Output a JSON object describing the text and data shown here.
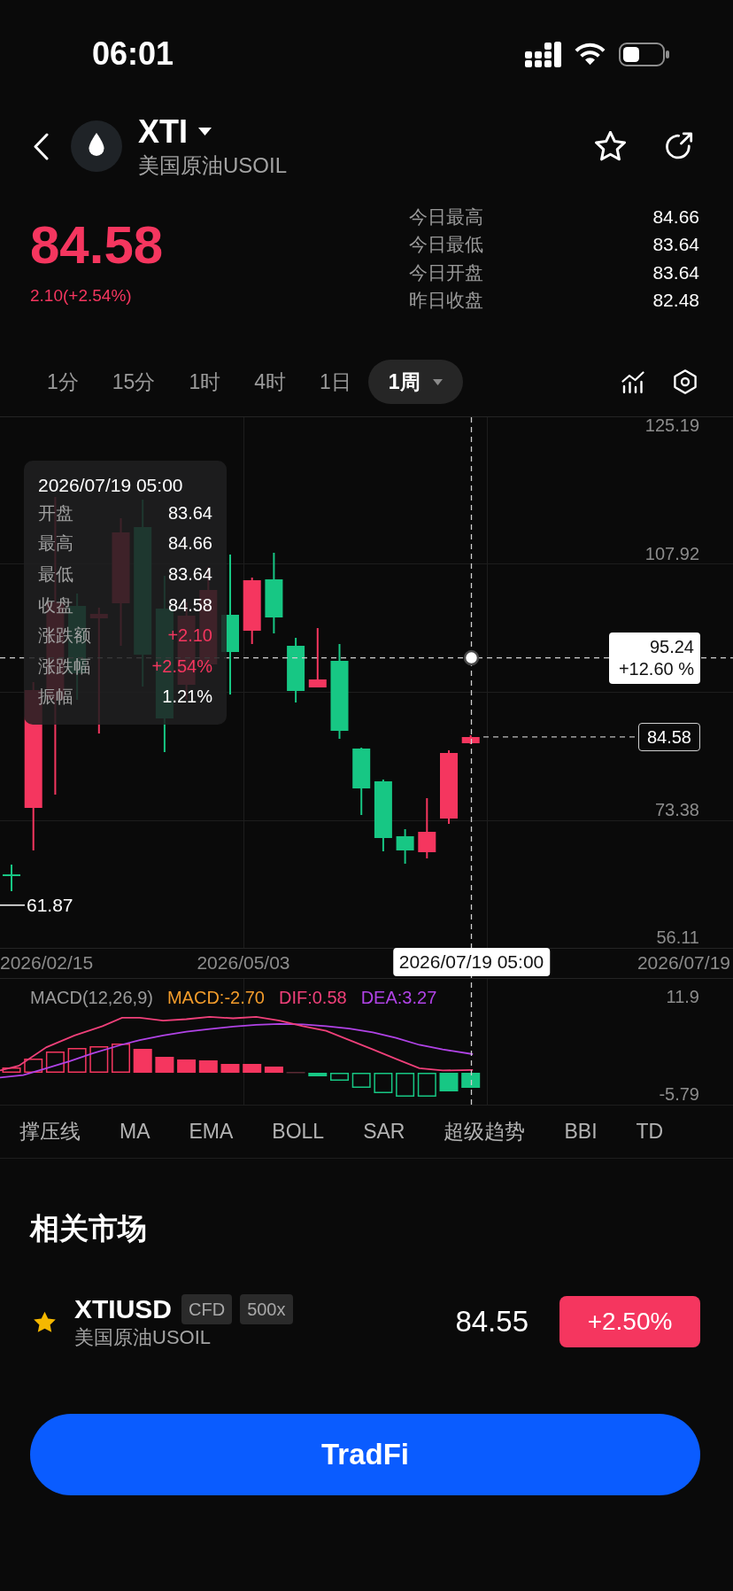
{
  "status_bar": {
    "time": "06:01"
  },
  "header": {
    "symbol": "XTI",
    "name": "美国原油USOIL",
    "favorite": false
  },
  "quote": {
    "price": "84.58",
    "change": "2.10(+2.54%)",
    "rising": true,
    "stats": [
      {
        "label": "今日最高",
        "value": "84.66"
      },
      {
        "label": "今日最低",
        "value": "83.64"
      },
      {
        "label": "今日开盘",
        "value": "83.64"
      },
      {
        "label": "昨日收盘",
        "value": "82.48"
      }
    ]
  },
  "timeframes": [
    {
      "label": "1分",
      "selected": false
    },
    {
      "label": "15分",
      "selected": false
    },
    {
      "label": "1时",
      "selected": false
    },
    {
      "label": "4时",
      "selected": false
    },
    {
      "label": "1日",
      "selected": false
    },
    {
      "label": "1周",
      "selected": true
    }
  ],
  "chart": {
    "y_axis_labels": [
      "125.19",
      "107.92",
      "73.38",
      "56.11"
    ],
    "x_axis_labels": [
      "2026/02/15",
      "2026/05/03",
      "2026/07/19"
    ],
    "tooltip": {
      "date": "2026/07/19 05:00",
      "rows": [
        {
          "label": "开盘",
          "value": "83.64",
          "positive": false
        },
        {
          "label": "最高",
          "value": "84.66",
          "positive": false
        },
        {
          "label": "最低",
          "value": "83.64",
          "positive": false
        },
        {
          "label": "收盘",
          "value": "84.58",
          "positive": false
        },
        {
          "label": "涨跌额",
          "value": "+2.10",
          "positive": true
        },
        {
          "label": "涨跌幅",
          "value": "+2.54%",
          "positive": true
        },
        {
          "label": "振幅",
          "value": "1.21%",
          "positive": false
        }
      ]
    },
    "crosshair": {
      "date": "2026/07/19 05:00",
      "price": "95.24",
      "change": "+12.60 %"
    },
    "last_price": "84.58",
    "low_marker": "61.87"
  },
  "macd": {
    "legend": [
      {
        "text": "MACD(12,26,9)",
        "color": "#9a9a9a"
      },
      {
        "text": "MACD:-2.70",
        "color": "#f39c2b"
      },
      {
        "text": "DIF:0.58",
        "color": "#f0407a"
      },
      {
        "text": "DEA:3.27",
        "color": "#b043e6"
      }
    ],
    "axis_labels": [
      "11.9",
      "-5.79"
    ]
  },
  "indicators": [
    {
      "label": "撑压线",
      "selected": false
    },
    {
      "label": "MA",
      "selected": false
    },
    {
      "label": "EMA",
      "selected": false
    },
    {
      "label": "BOLL",
      "selected": false
    },
    {
      "label": "SAR",
      "selected": false
    },
    {
      "label": "超级趋势",
      "selected": false
    },
    {
      "label": "BBI",
      "selected": false
    },
    {
      "label": "TD",
      "selected": false
    }
  ],
  "related_markets": {
    "title": "相关市场",
    "items": [
      {
        "symbol": "XTIUSD",
        "tags": [
          "CFD",
          "500x"
        ],
        "name": "美国原油USOIL",
        "price": "84.55",
        "change": "+2.50%",
        "rising": true,
        "favorite": true
      }
    ]
  },
  "primary_button": {
    "label": "TradFi"
  }
}
